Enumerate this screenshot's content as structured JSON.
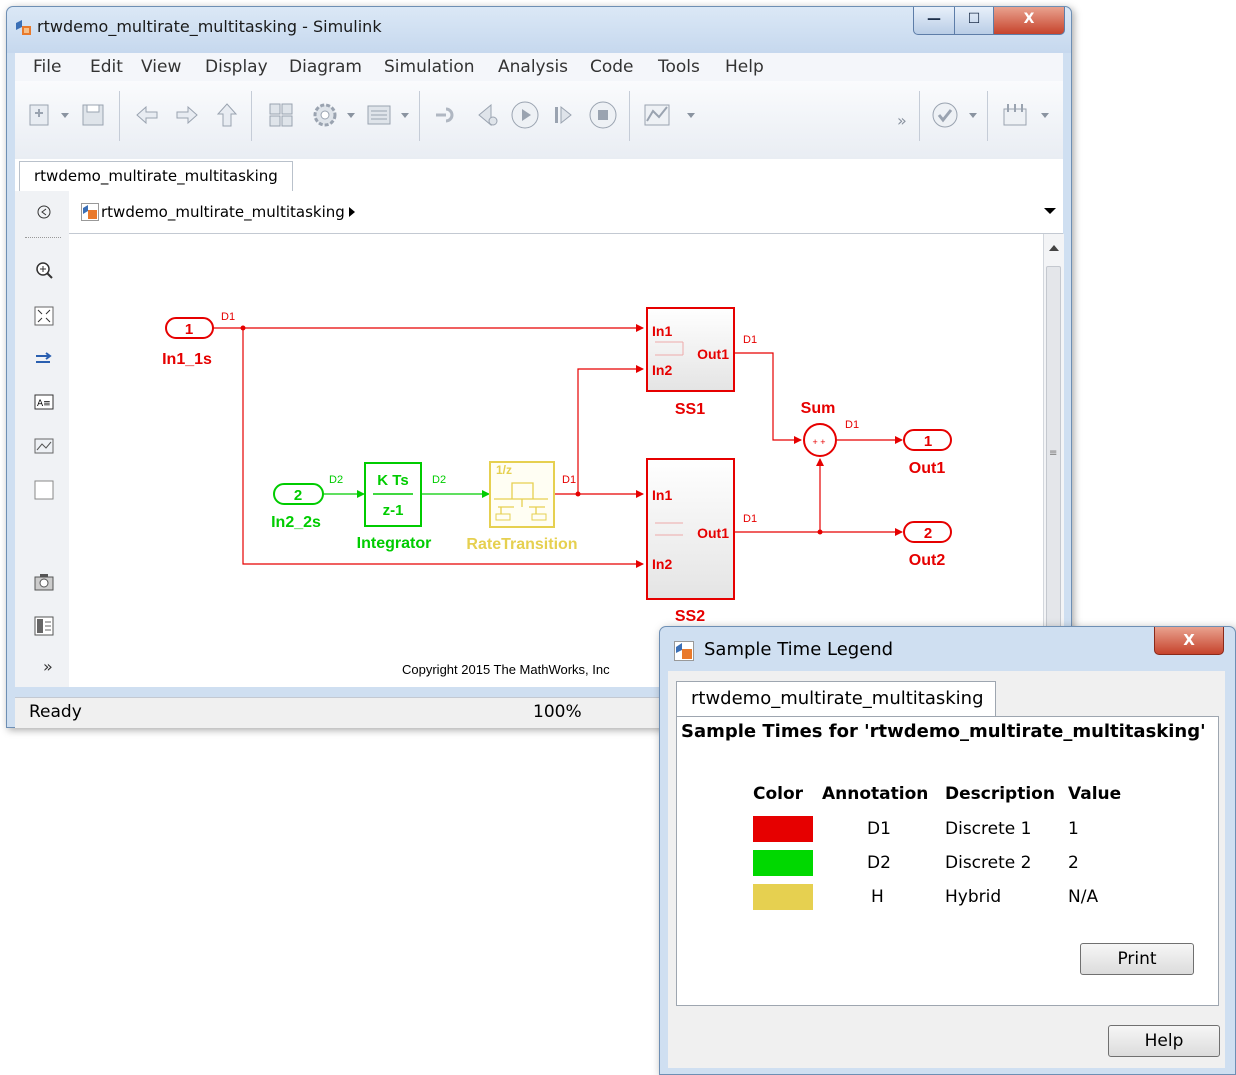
{
  "window": {
    "title": "rtwdemo_multirate_multitasking - Simulink",
    "controls": {
      "minimize": "—",
      "maximize": "☐",
      "close": "X"
    }
  },
  "menu": [
    "File",
    "Edit",
    "View",
    "Display",
    "Diagram",
    "Simulation",
    "Analysis",
    "Code",
    "Tools",
    "Help"
  ],
  "toolbar": {
    "overflow": "»"
  },
  "tab": {
    "label": "rtwdemo_multirate_multitasking"
  },
  "address": {
    "path": "rtwdemo_multirate_multitasking"
  },
  "diagram": {
    "inports": [
      {
        "number": "1",
        "label": "In1_1s"
      },
      {
        "number": "2",
        "label": "In2_2s"
      }
    ],
    "outports": [
      {
        "number": "1",
        "label": "Out1"
      },
      {
        "number": "2",
        "label": "Out2"
      }
    ],
    "integrator": {
      "label": "Integrator",
      "numerator": "K Ts",
      "denominator": "z-1"
    },
    "rate_transition": {
      "label": "RateTransition",
      "text": "1/z"
    },
    "ss1": {
      "label": "SS1",
      "in1": "In1",
      "in2": "In2",
      "out1": "Out1"
    },
    "ss2": {
      "label": "SS2",
      "in1": "In1",
      "in2": "In2",
      "out1": "Out1"
    },
    "sum": {
      "label": "Sum",
      "signs": "+ +"
    },
    "signal_tags": {
      "d1": "D1",
      "d2": "D2"
    },
    "copyright": "Copyright 2015 The MathWorks, Inc"
  },
  "status": {
    "ready": "Ready",
    "zoom": "100%"
  },
  "colors": {
    "d1": "#e60000",
    "d2": "#00d800",
    "hybrid": "#e6d050"
  },
  "dialog": {
    "title": "Sample Time Legend",
    "close": "X",
    "tab": "rtwdemo_multirate_multitasking",
    "heading": "Sample Times for 'rtwdemo_multirate_multitasking'",
    "columns": [
      "Color",
      "Annotation",
      "Description",
      "Value"
    ],
    "rows": [
      {
        "color": "#e60000",
        "annotation": "D1",
        "description": "Discrete 1",
        "value": "1"
      },
      {
        "color": "#00d800",
        "annotation": "D2",
        "description": "Discrete 2",
        "value": "2"
      },
      {
        "color": "#e6d050",
        "annotation": "H",
        "description": "Hybrid",
        "value": "N/A"
      }
    ],
    "print": "Print",
    "help": "Help"
  }
}
